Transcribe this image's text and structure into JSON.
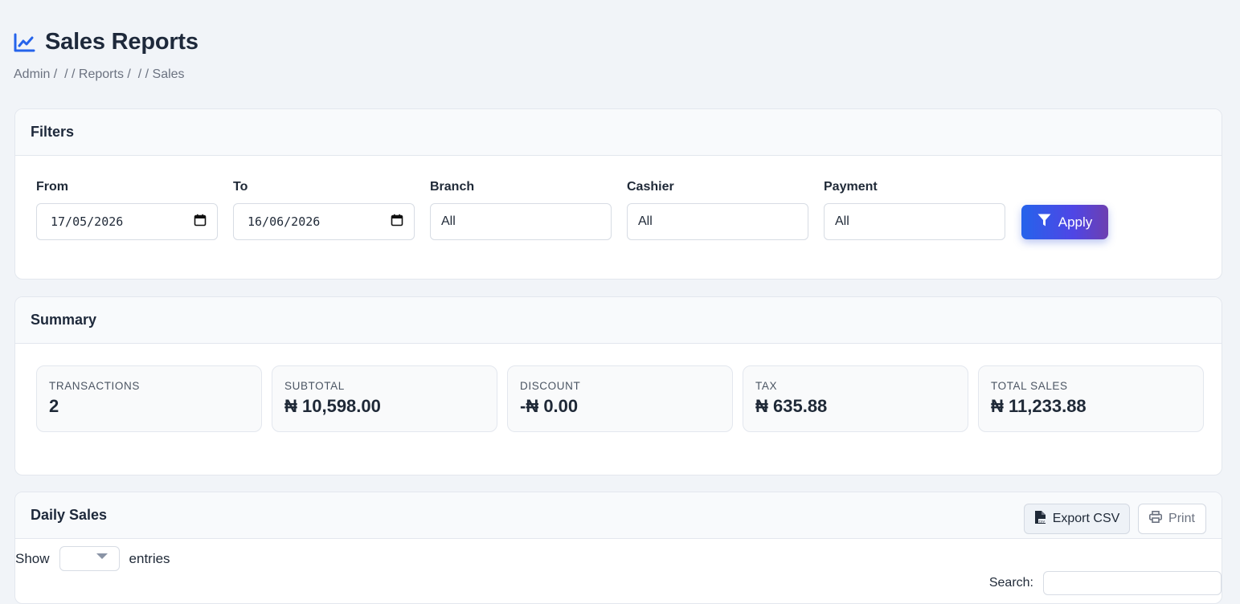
{
  "header": {
    "title": "Sales Reports",
    "breadcrumb": [
      "Admin / ",
      " / / ",
      "Reports / ",
      " / / ",
      "Sales"
    ]
  },
  "filters": {
    "title": "Filters",
    "from": {
      "label": "From",
      "value": "17/05/2026"
    },
    "to": {
      "label": "To",
      "value": "16/06/2026"
    },
    "branch": {
      "label": "Branch",
      "value": "All"
    },
    "cashier": {
      "label": "Cashier",
      "value": "All"
    },
    "payment": {
      "label": "Payment",
      "value": "All"
    },
    "apply_label": "Apply"
  },
  "summary": {
    "title": "Summary",
    "stats": [
      {
        "label": "TRANSACTIONS",
        "value": "2"
      },
      {
        "label": "SUBTOTAL",
        "value": "₦ 10,598.00"
      },
      {
        "label": "DISCOUNT",
        "value": "-₦ 0.00"
      },
      {
        "label": "TAX",
        "value": "₦ 635.88"
      },
      {
        "label": "TOTAL SALES",
        "value": "₦ 11,233.88"
      }
    ]
  },
  "daily": {
    "title": "Daily Sales",
    "export_label": "Export CSV",
    "print_label": "Print",
    "show_label": "Show",
    "entries_label": "entries",
    "search_label": "Search:"
  },
  "colors": {
    "accent": "#2563eb",
    "background": "#f1f4f8"
  }
}
